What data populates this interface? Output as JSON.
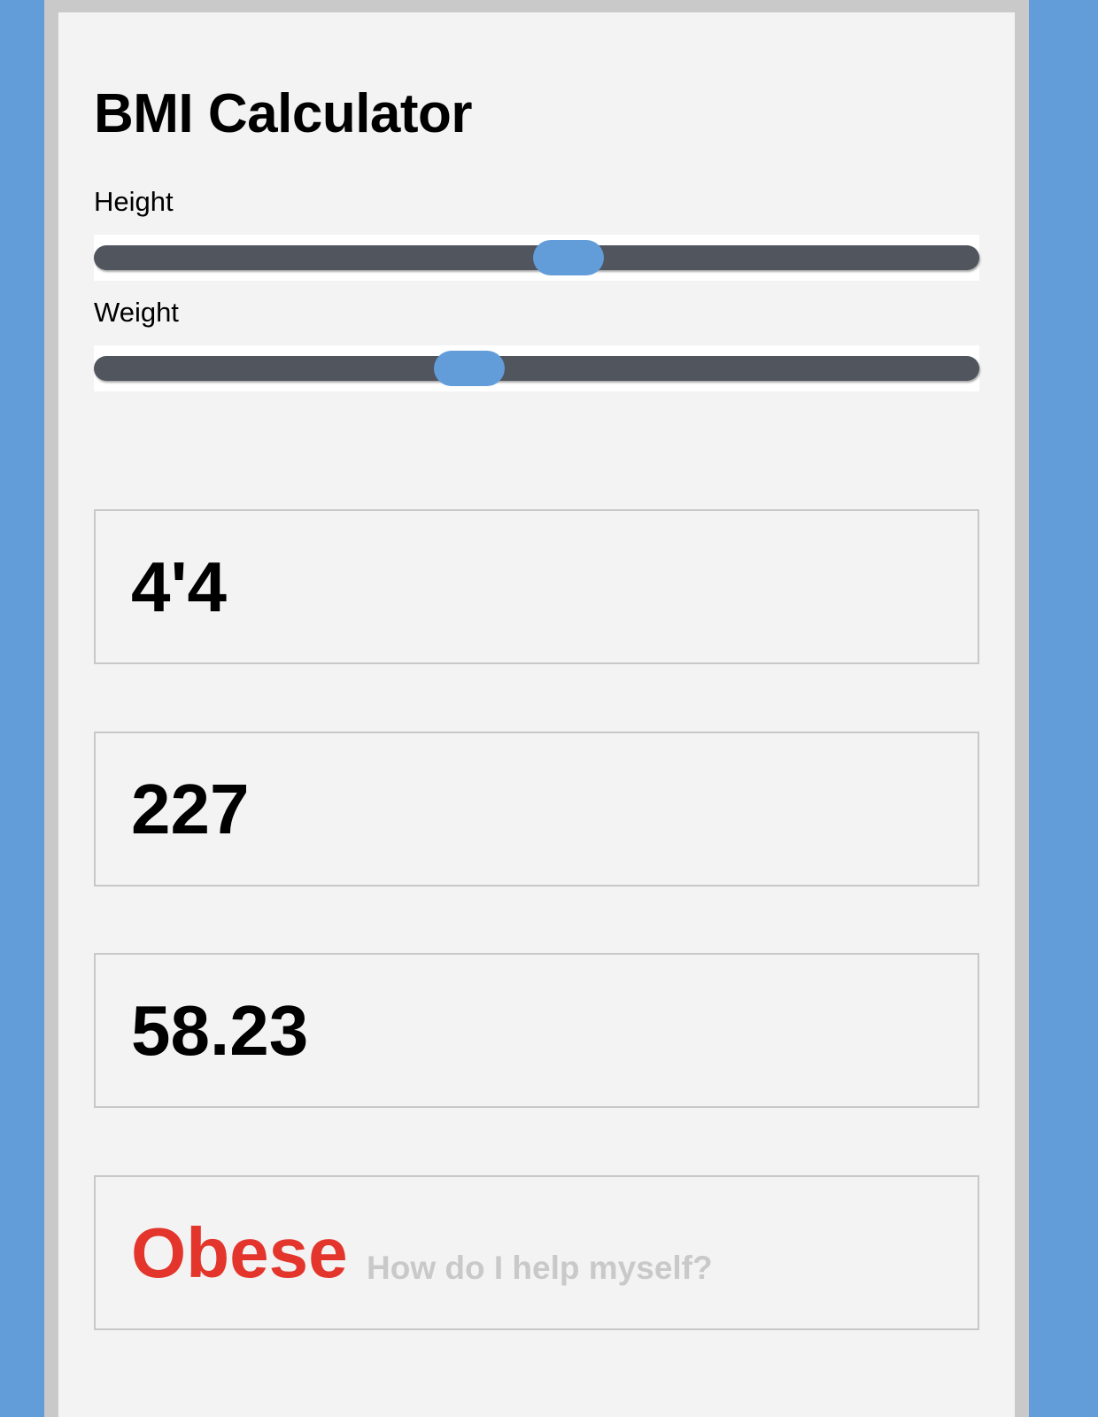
{
  "app": {
    "title": "BMI Calculator"
  },
  "sliders": {
    "height": {
      "label": "Height",
      "position_fraction": 0.536
    },
    "weight": {
      "label": "Weight",
      "position_fraction": 0.424
    }
  },
  "results": {
    "height_display": "4'4",
    "weight_display": "227",
    "bmi": "58.23",
    "category": "Obese",
    "help_link": "How do I help myself?"
  },
  "colors": {
    "accent": "#629dda",
    "track": "#50555e",
    "category": "#e3352b",
    "help_link": "#c9c9c9"
  }
}
